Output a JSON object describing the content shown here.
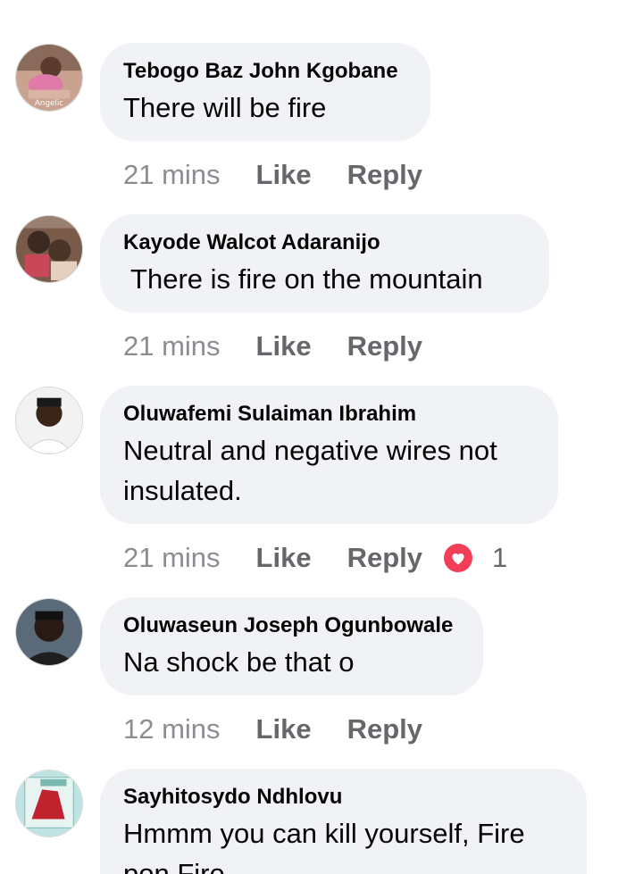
{
  "colors": {
    "bubble": "#f0f2f5",
    "meta_text": "#65676b",
    "heart": "#f33e58"
  },
  "comments": [
    {
      "author": "Tebogo Baz John Kgobane",
      "text": "There will be fire",
      "avatar_label": "Angelic",
      "time": "21 mins",
      "like": "Like",
      "reply": "Reply"
    },
    {
      "author": "Kayode Walcot Adaranijo",
      "text": " There is fire on the mountain",
      "time": "21 mins",
      "like": "Like",
      "reply": "Reply"
    },
    {
      "author": "Oluwafemi Sulaiman Ibrahim",
      "text": "Neutral and negative wires not insulated.",
      "time": "21 mins",
      "like": "Like",
      "reply": "Reply",
      "reaction_icon": "heart-icon",
      "reaction_count": "1"
    },
    {
      "author": "Oluwaseun Joseph Ogunbowale",
      "text": "Na shock be that o",
      "time": "12 mins",
      "like": "Like",
      "reply": "Reply"
    },
    {
      "author": "Sayhitosydo Ndhlovu",
      "text": "Hmmm you can kill yourself, Fire pon Fire"
    }
  ]
}
